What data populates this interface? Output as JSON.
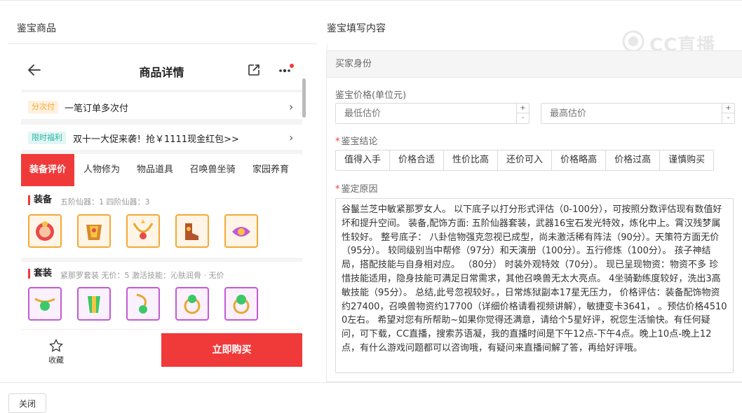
{
  "left_section": {
    "title": "鉴宝商品"
  },
  "right_section": {
    "title": "鉴宝填写内容"
  },
  "phone": {
    "title": "商品详情",
    "installment": {
      "tag": "分次付",
      "text": "一笔订单多次付"
    },
    "promo": {
      "tag": "限时福利",
      "text": "双十一大促来袭！抢￥1111现金红包>>"
    },
    "tabs": [
      "装备评价",
      "人物修为",
      "物品道具",
      "召唤兽坐骑",
      "家园养育"
    ],
    "equip_group": {
      "title": "装备",
      "sub": "五阶仙器：1   四阶仙器：3"
    },
    "set_group": {
      "title": "套装",
      "sub": "紧那罗套装   无价：5   激活技能：沁肤润骨 · 无价"
    },
    "favorite_label": "收藏",
    "buy_label": "立即购买"
  },
  "form": {
    "section_label": "买家身份",
    "price_label": "鉴宝价格(单位元)",
    "min_placeholder": "最低估价",
    "max_placeholder": "最高估价",
    "conclusion_label": "鉴宝结论",
    "conclusion_options": [
      "值得入手",
      "价格合适",
      "性价比高",
      "还价可入",
      "价格略高",
      "价格过高",
      "谨慎购买"
    ],
    "reason_label": "鉴定原因",
    "reason_text": "谷鬣兰芝中敏紧那罗女人。 以下底子以打分形式评估（0-100分），可按照分数评估现有数值好坏和提升空间。 装备,配饰方面: 五阶仙器套装，武器16宝石发光特效，炼化中上。霄汉残梦属性较好。 整号底子： 八卦信物强克忽视已成型，尚未激活稀有阵法（90分）。天策符方面无价（95分）。 较同级别当中帮修（97分）和天演册（100分）。五行修炼（100分）。 孩子神结局，搭配技能与自身相对应。 （80分） 时装外观特效（70分）。 现已呈现物资：物资不多 珍惜技能适用，隐身技能可满足日常需求，其他召唤兽无太大亮点。 4坐骑勤练度较好，洗出3高敏技能（95分）。 总结,此号忽视较好。，日常炼狱副本17星无压力， 价格评估：装备配饰物资约27400，召唤兽物资约17700（详细价格请看视频讲解），敏捷变卡3641， 。预估价格45100左右。 希望对您有所帮助~如果你觉得还满意，请给个5星好评，祝您生活愉快。有任何疑问，可下载，CC直播，搜索苏语凝，我的直播时间是下午12点-下午4点。晚上10点-晚上12点，有什么游戏问题都可以咨询哦，有疑问来直播间解了答，再给好评哦。"
  },
  "watermark": "CC直播",
  "footer": {
    "close_label": "关闭"
  },
  "colors": {
    "accent": "#f03a3a",
    "installment_tag": "#f5a833",
    "promo_tag": "#2bb5a8"
  }
}
